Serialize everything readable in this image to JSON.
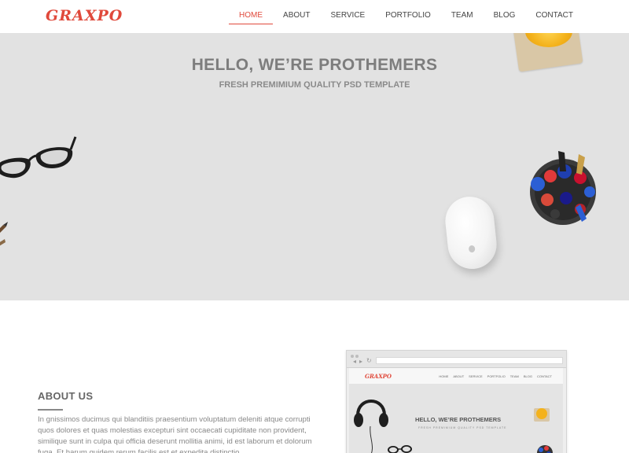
{
  "logo": "GRAXPO",
  "nav": [
    "HOME",
    "ABOUT",
    "SERVICE",
    "PORTFOLIO",
    "TEAM",
    "BLOG",
    "CONTACT"
  ],
  "nav_active": "HOME",
  "hero": {
    "title": "HELLO, WE’RE PROTHEMERS",
    "subtitle": "FRESH PREMIMIUM QUALITY PSD TEMPLATE"
  },
  "about": {
    "title": "ABOUT US",
    "text": "In gnissimos ducimus qui blanditiis praesentium voluptatum deleniti atque corrupti quos dolores et quas molestias excepturi sint occaecati cupiditate non provident, similique sunt in culpa qui officia deserunt mollitia animi, id est laborum et dolorum fuga. Et harum quidem rerum facilis est et expedita distinctio."
  },
  "mockup": {
    "logo": "GRAXPO",
    "nav": [
      "HOME",
      "ABOUT",
      "SERVICE",
      "PORTFOLIO",
      "TEAM",
      "BLOG",
      "CONTACT"
    ],
    "hero_title": "HELLO, WE’RE PROTHEMERS",
    "hero_subtitle": "FRESH PREMIMIUM QUALITY PSD TEMPLATE"
  },
  "colors": {
    "accent": "#e0493b",
    "hero_bg": "#e2e2e2"
  }
}
